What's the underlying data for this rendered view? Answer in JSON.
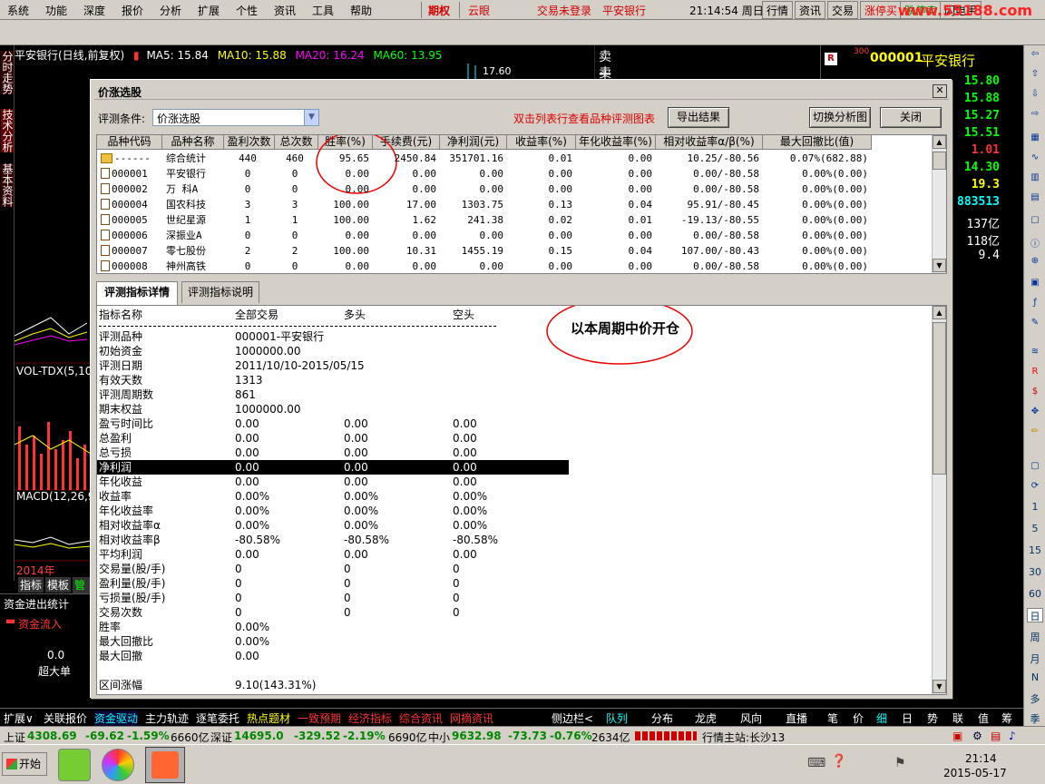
{
  "menu": {
    "items": [
      "系统",
      "功能",
      "深度",
      "报价",
      "分析",
      "扩展",
      "个性",
      "资讯",
      "工具",
      "帮助"
    ],
    "futures": "期权",
    "cloud": "云眼",
    "trade_status": "交易未登录",
    "stock_name": "平安银行",
    "time": "21:14:54 周日",
    "right_buttons": [
      "行情",
      "资讯",
      "交易",
      "涨停买",
      "跌停卖",
      "闪电手"
    ],
    "watermark": "www.55188.com"
  },
  "left_tabs": [
    "分时走势",
    "技术分析",
    "基本资料"
  ],
  "chart": {
    "header": {
      "stock": "平安银行(日线,前复权)",
      "ma5": "MA5: 15.84",
      "ma10": "MA10: 15.88",
      "ma20": "MA20: 16.24",
      "ma60": "MA60: 13.95"
    },
    "price_label": "17.60",
    "vol_label": "VOL-TDX(5,10)",
    "macd_label": "MACD(12,26,9)",
    "year_label": "2014年",
    "bottom_tabs": [
      "指标",
      "模板",
      "管理"
    ],
    "fund_title": "资金进出统计",
    "fund_in": "资金流入",
    "fund_value": "0.0",
    "big_order": "超大单",
    "order_book": [
      "卖十",
      "卖九"
    ]
  },
  "quote": {
    "badge": "R",
    "badge_sub": "300",
    "code": "000001",
    "name": "平安银行",
    "values": [
      "15.80",
      "15.88",
      "15.27",
      "15.51",
      "1.01",
      "14.30",
      "19.3",
      "883513",
      "137亿",
      "118亿",
      "9.4"
    ]
  },
  "dialog": {
    "title": "价涨选股",
    "condition_label": "评测条件:",
    "condition_value": "价涨选股",
    "hint": "双击列表行查看品种评测图表",
    "buttons": {
      "export": "导出结果",
      "switch_chart": "切换分析图",
      "close": "关闭"
    },
    "columns": [
      "品种代码",
      "品种名称",
      "盈利次数",
      "总次数",
      "胜率(%)",
      "手续费(元)",
      "净利润(元)",
      "收益率(%)",
      "年化收益率(%)",
      "相对收益率α/β(%)",
      "最大回撤比(值)"
    ],
    "rows": [
      {
        "code": "------",
        "name": "综合统计",
        "wins": "440",
        "total": "460",
        "rate": "95.65",
        "fee": "2450.84",
        "profit": "351701.16",
        "ret": "0.01",
        "annual": "0.00",
        "rel": "10.25/-80.56",
        "dd": "0.07%(682.88)",
        "folder": true
      },
      {
        "code": "000001",
        "name": "平安银行",
        "wins": "0",
        "total": "0",
        "rate": "0.00",
        "fee": "0.00",
        "profit": "0.00",
        "ret": "0.00",
        "annual": "0.00",
        "rel": "0.00/-80.58",
        "dd": "0.00%(0.00)"
      },
      {
        "code": "000002",
        "name": "万  科A",
        "wins": "0",
        "total": "0",
        "rate": "0.00",
        "fee": "0.00",
        "profit": "0.00",
        "ret": "0.00",
        "annual": "0.00",
        "rel": "0.00/-80.58",
        "dd": "0.00%(0.00)"
      },
      {
        "code": "000004",
        "name": "国农科技",
        "wins": "3",
        "total": "3",
        "rate": "100.00",
        "fee": "17.00",
        "profit": "1303.75",
        "ret": "0.13",
        "annual": "0.04",
        "rel": "95.91/-80.45",
        "dd": "0.00%(0.00)"
      },
      {
        "code": "000005",
        "name": "世纪星源",
        "wins": "1",
        "total": "1",
        "rate": "100.00",
        "fee": "1.62",
        "profit": "241.38",
        "ret": "0.02",
        "annual": "0.01",
        "rel": "-19.13/-80.55",
        "dd": "0.00%(0.00)"
      },
      {
        "code": "000006",
        "name": "深振业A",
        "wins": "0",
        "total": "0",
        "rate": "0.00",
        "fee": "0.00",
        "profit": "0.00",
        "ret": "0.00",
        "annual": "0.00",
        "rel": "0.00/-80.58",
        "dd": "0.00%(0.00)"
      },
      {
        "code": "000007",
        "name": "零七股份",
        "wins": "2",
        "total": "2",
        "rate": "100.00",
        "fee": "10.31",
        "profit": "1455.19",
        "ret": "0.15",
        "annual": "0.04",
        "rel": "107.00/-80.43",
        "dd": "0.00%(0.00)"
      },
      {
        "code": "000008",
        "name": "神州高铁",
        "wins": "0",
        "total": "0",
        "rate": "0.00",
        "fee": "0.00",
        "profit": "0.00",
        "ret": "0.00",
        "annual": "0.00",
        "rel": "0.00/-80.58",
        "dd": "0.00%(0.00)"
      }
    ],
    "tabs": [
      "评测指标详情",
      "评测指标说明"
    ],
    "detail_header": [
      "指标名称",
      "全部交易",
      "多头",
      "空头"
    ],
    "detail_rows": [
      [
        "评测品种",
        "000001-平安银行",
        "",
        ""
      ],
      [
        "初始资金",
        "1000000.00",
        "",
        ""
      ],
      [
        "评测日期",
        "2011/10/10-2015/05/15",
        "",
        ""
      ],
      [
        "有效天数",
        "1313",
        "",
        ""
      ],
      [
        "评测周期数",
        "861",
        "",
        ""
      ],
      [
        "期末权益",
        "1000000.00",
        "",
        ""
      ],
      [
        "盈亏时间比",
        "0.00",
        "0.00",
        "0.00"
      ],
      [
        "总盈利",
        "0.00",
        "0.00",
        "0.00"
      ],
      [
        "总亏损",
        "0.00",
        "0.00",
        "0.00"
      ],
      [
        "净利润",
        "0.00",
        "0.00",
        "0.00"
      ],
      [
        "年化收益",
        "0.00",
        "0.00",
        "0.00"
      ],
      [
        "收益率",
        "0.00%",
        "0.00%",
        "0.00%"
      ],
      [
        "年化收益率",
        "0.00%",
        "0.00%",
        "0.00%"
      ],
      [
        "相对收益率α",
        "0.00%",
        "0.00%",
        "0.00%"
      ],
      [
        "相对收益率β",
        "-80.58%",
        "-80.58%",
        "-80.58%"
      ],
      [
        "平均利润",
        "0.00",
        "0.00",
        "0.00"
      ],
      [
        "交易量(股/手)",
        "0",
        "0",
        "0"
      ],
      [
        "盈利量(股/手)",
        "0",
        "0",
        "0"
      ],
      [
        "亏损量(股/手)",
        "0",
        "0",
        "0"
      ],
      [
        "交易次数",
        "0",
        "0",
        "0"
      ],
      [
        "胜率",
        "0.00%",
        "",
        ""
      ],
      [
        "最大回撤比",
        "0.00%",
        "",
        ""
      ],
      [
        "最大回撤",
        "0.00",
        "",
        ""
      ],
      [
        "",
        "",
        "",
        ""
      ],
      [
        "区间涨幅",
        "9.10(143.31%)",
        "",
        ""
      ]
    ],
    "selected_row": 9,
    "annotation": "以本周期中价开仓"
  },
  "bottom1": [
    "扩展∨",
    "关联报价",
    "资金驱动",
    "主力轨迹",
    "逐笔委托",
    "热点题材",
    "一致预期",
    "经济指标",
    "综合资讯",
    "网摘资讯",
    "侧边栏<",
    "队列",
    "分布",
    "龙虎",
    "风向",
    "直播",
    "笔",
    "价",
    "细",
    "日",
    "势",
    "联",
    "值",
    "筹"
  ],
  "bottom2": {
    "sh": "上证",
    "sh_val": "4308.69",
    "sh_chg": "-69.62",
    "sh_pct": "-1.59%",
    "sh_amt": "6660亿",
    "sz": "深证",
    "sz_val": "14695.0",
    "sz_chg": "-329.52",
    "sz_pct": "-2.19%",
    "sz_amt": "6690亿",
    "zx": "中小",
    "zx_val": "9632.98",
    "zx_chg": "-73.73",
    "zx_pct": "-0.76%",
    "zx_amt": "2634亿",
    "server": "行情主站:长沙13"
  },
  "rtool_labels": [
    "1",
    "5",
    "15",
    "30",
    "60",
    "日",
    "周",
    "月",
    "N",
    "多",
    "季"
  ],
  "taskbar": {
    "start": "开始",
    "time": "21:14",
    "date": "2015-05-17"
  },
  "colors": {
    "red": "#ff3030",
    "green": "#00e000",
    "yellow": "#ffff00",
    "cyan": "#00ffff"
  }
}
